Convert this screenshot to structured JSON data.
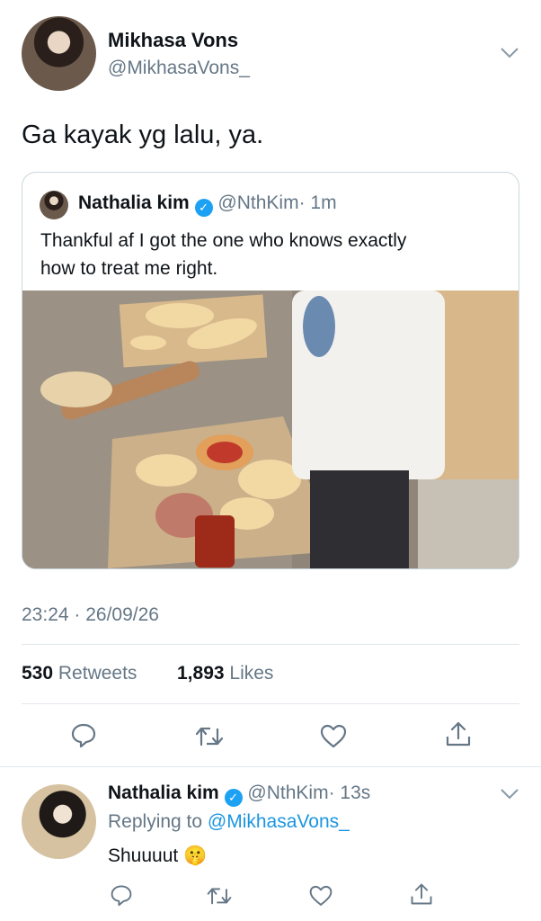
{
  "tweet": {
    "author_name": "Mikhasa Vons",
    "author_handle": "@MikhasaVons_",
    "text": "Ga kayak yg lalu, ya.",
    "timestamp": "23:24 · 26/09/26",
    "stats": {
      "retweets_count": "530",
      "retweets_label": "Retweets",
      "likes_count": "1,893",
      "likes_label": "Likes"
    }
  },
  "quoted": {
    "author_name": "Nathalia kim",
    "author_handle": "@NthKim",
    "time": "· 1m",
    "text_line1": "Thankful af I got the one who knows exactly",
    "text_line2": "how to treat me right."
  },
  "reply": {
    "author_name": "Nathalia kim",
    "author_handle": "@NthKim",
    "time": "· 13s",
    "replying_label": "Replying to",
    "replying_to": "@MikhasaVons_",
    "text": "Shuuuut",
    "emoji": "🤫"
  },
  "icons": {
    "reply": "reply-icon",
    "retweet": "retweet-icon",
    "like": "heart-icon",
    "share": "share-icon",
    "more": "chevron-down-icon",
    "verified": "verified-badge-icon"
  },
  "colors": {
    "text": "#0f1419",
    "secondary": "#657786",
    "link": "#1b95e0",
    "verified": "#1da1f2",
    "divider": "#e1e8ed"
  }
}
